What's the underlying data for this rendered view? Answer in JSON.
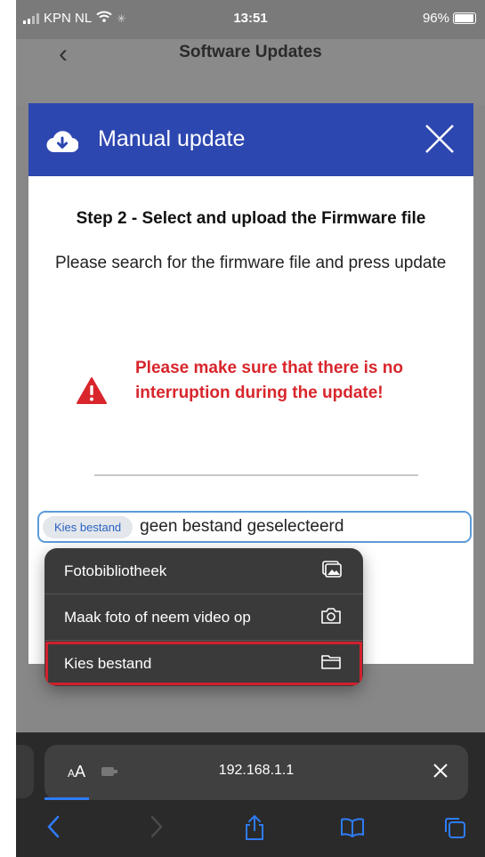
{
  "status_bar": {
    "carrier": "KPN NL",
    "time": "13:51",
    "battery": "96%"
  },
  "page": {
    "title": "Software Updates"
  },
  "modal": {
    "title": "Manual update",
    "step_heading": "Step 2 - Select and upload the Firmware file",
    "description": "Please search for the firmware file and press update",
    "warning": "Please make sure that there is no interruption during the update!",
    "file_button_label": "Kies bestand",
    "file_status": "geen bestand geselecteerd"
  },
  "menu": {
    "items": [
      {
        "label": "Fotobibliotheek",
        "icon": "photo-library-icon"
      },
      {
        "label": "Maak foto of neem video op",
        "icon": "camera-icon"
      },
      {
        "label": "Kies bestand",
        "icon": "folder-icon"
      }
    ]
  },
  "browser": {
    "text_size_label": "AA",
    "url": "192.168.1.1"
  },
  "colors": {
    "modal_header": "#2d47b0",
    "warning": "#d8262c",
    "highlight": "#d0202d",
    "link": "#2b63c4"
  }
}
